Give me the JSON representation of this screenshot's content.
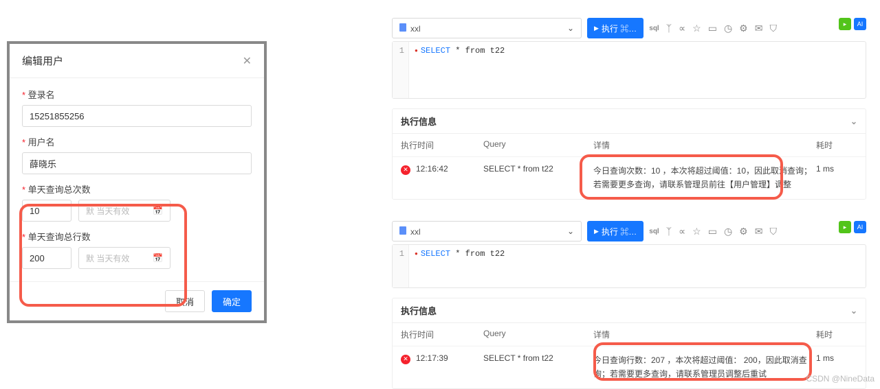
{
  "dialog": {
    "title": "编辑用户",
    "login_label": "登录名",
    "login_value": "15251855256",
    "username_label": "用户名",
    "username_value": "薛晓乐",
    "daily_query_count_label": "单天查询总次数",
    "daily_query_count_value": "10",
    "daily_query_rows_label": "单天查询总行数",
    "daily_query_rows_value": "200",
    "date_placeholder": "默 当天有效",
    "cancel_label": "取消",
    "confirm_label": "确定"
  },
  "panel1": {
    "db_name": "xxl",
    "exec_label": "执行 ⌘…",
    "sql_keyword": "SELECT",
    "sql_rest": " * from t22",
    "line_no": "1",
    "result_title": "执行信息",
    "col_time": "执行时间",
    "col_query": "Query",
    "col_detail": "详情",
    "col_cost": "耗时",
    "row_time": "12:16:42",
    "row_query": "SELECT * from t22",
    "row_detail": "今日查询次数：10 ，本次将超过阈值：10，因此取消查询；若需要更多查询，请联系管理员前往【用户管理】调整",
    "row_cost": "1 ms"
  },
  "panel2": {
    "db_name": "xxl",
    "exec_label": "执行 ⌘…",
    "sql_keyword": "SELECT",
    "sql_rest": " * from t22",
    "line_no": "1",
    "result_title": "执行信息",
    "col_time": "执行时间",
    "col_query": "Query",
    "col_detail": "详情",
    "col_cost": "耗时",
    "row_time": "12:17:39",
    "row_query": "SELECT * from t22",
    "row_detail": "今日查询行数：207 ，本次将超过阈值： 200，因此取消查询；若需要更多查询，请联系管理员调整后重试",
    "row_cost": "1 ms"
  },
  "watermark": "CSDN @NineData",
  "icons": {
    "sql": "sql",
    "spark": "⚙",
    "filter": "ᛉ",
    "share": "∝",
    "star": "☆",
    "folder": "▭",
    "clock": "◷",
    "gear": "⚙",
    "mail": "✉",
    "shield": "⛉",
    "chevron": "⌄",
    "calendar": "📅",
    "close": "✕"
  }
}
